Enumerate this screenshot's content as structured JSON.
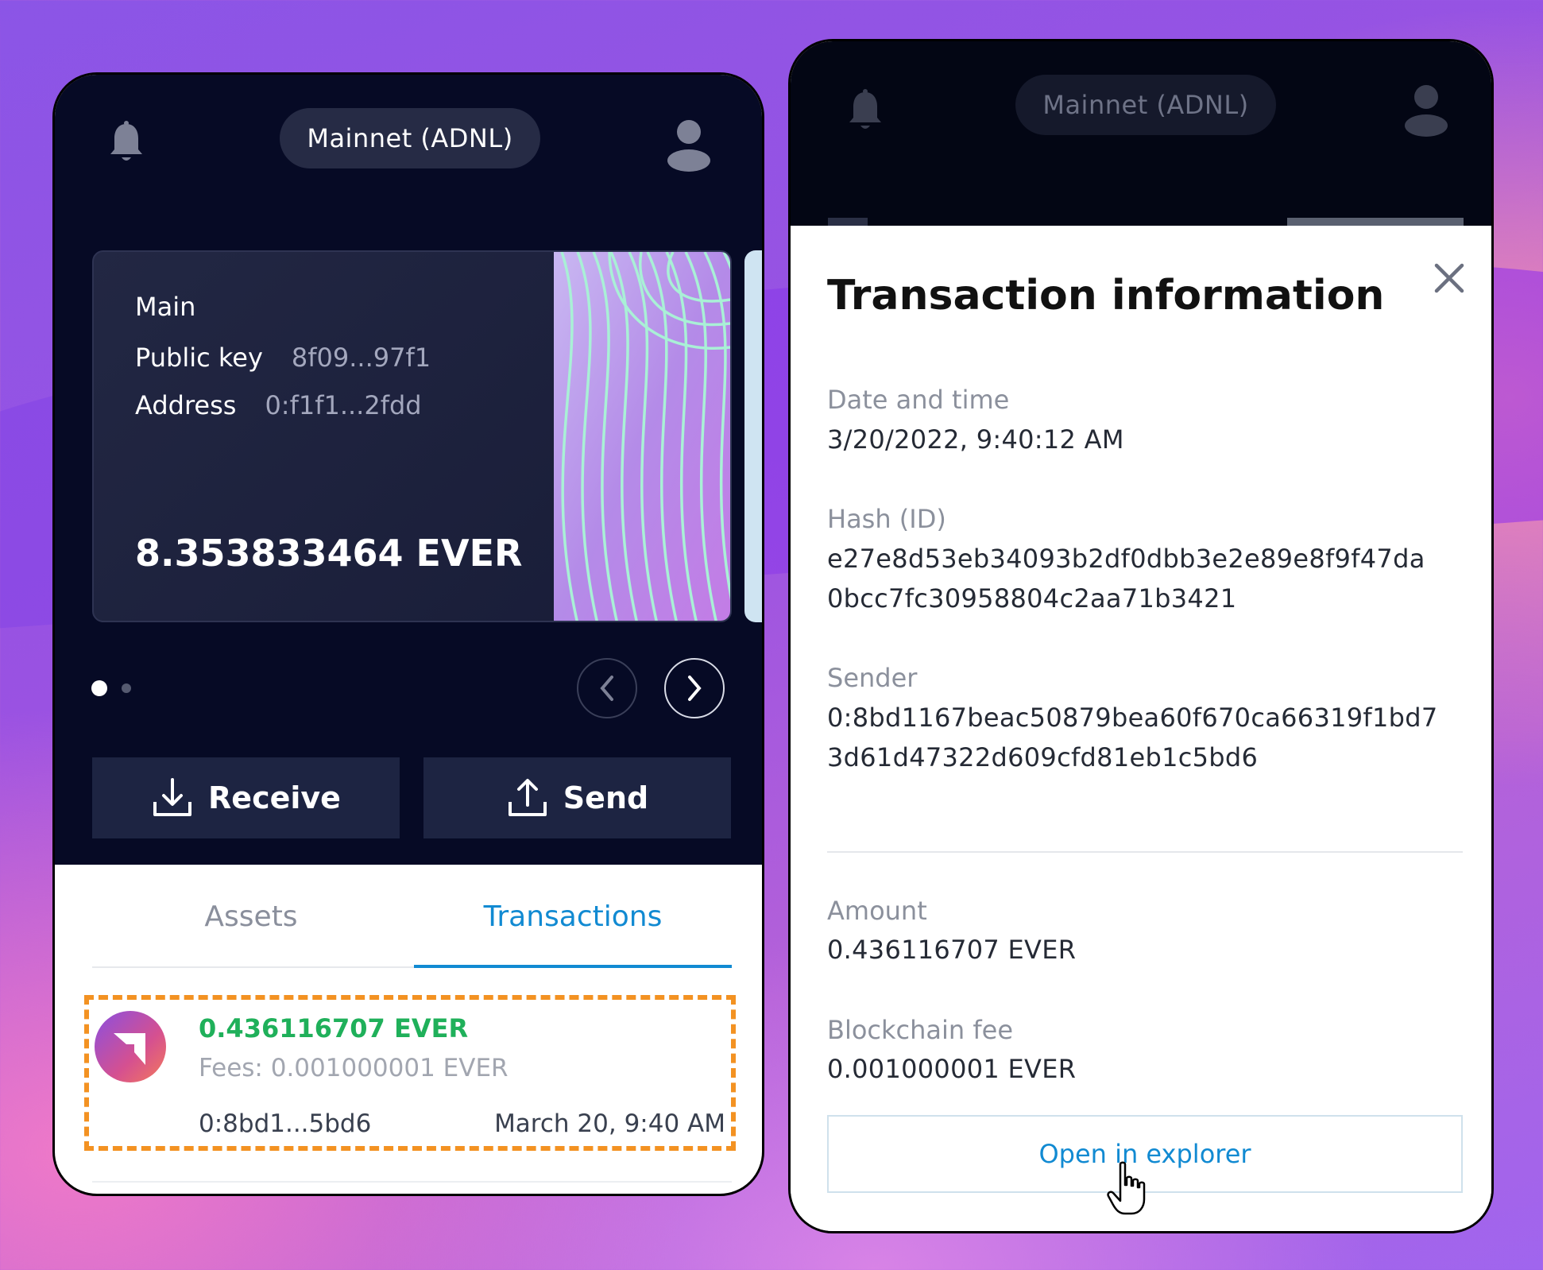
{
  "left": {
    "network": "Mainnet (ADNL)",
    "account": {
      "name": "Main",
      "public_key_label": "Public key",
      "public_key": "8f09...97f1",
      "address_label": "Address",
      "address": "0:f1f1...2fdd",
      "balance": "8.353833464 EVER"
    },
    "actions": {
      "receive": "Receive",
      "send": "Send"
    },
    "tabs": {
      "assets": "Assets",
      "transactions": "Transactions",
      "active": "Transactions"
    },
    "transaction": {
      "amount": "0.436116707 EVER",
      "fees": "Fees: 0.001000001 EVER",
      "address": "0:8bd1...5bd6",
      "date": "March 20, 9:40 AM"
    }
  },
  "right": {
    "network": "Mainnet (ADNL)",
    "modal": {
      "title": "Transaction information",
      "date_label": "Date and time",
      "date_value": "3/20/2022, 9:40:12 AM",
      "hash_label": "Hash (ID)",
      "hash_line1": "e27e8d53eb34093b2df0dbb3e2e89e8f9f47da",
      "hash_line2": "0bcc7fc30958804c2aa71b3421",
      "sender_label": "Sender",
      "sender_line1": "0:8bd1167beac50879bea60f670ca66319f1bd7",
      "sender_line2": "3d61d47322d609cfd81eb1c5bd6",
      "amount_label": "Amount",
      "amount_value": "0.436116707 EVER",
      "fee_label": "Blockchain fee",
      "fee_value": "0.001000001 EVER",
      "explorer_button": "Open in explorer"
    }
  },
  "colors": {
    "accent": "#118ad2",
    "amount_green": "#1fb05a",
    "highlight_orange": "#f39222",
    "header_dark": "#060a25"
  },
  "icons": [
    "bell-icon",
    "user-icon",
    "chevron-left-icon",
    "chevron-right-icon",
    "download-icon",
    "upload-icon",
    "close-icon",
    "hand-cursor-icon",
    "ever-logo-icon"
  ]
}
